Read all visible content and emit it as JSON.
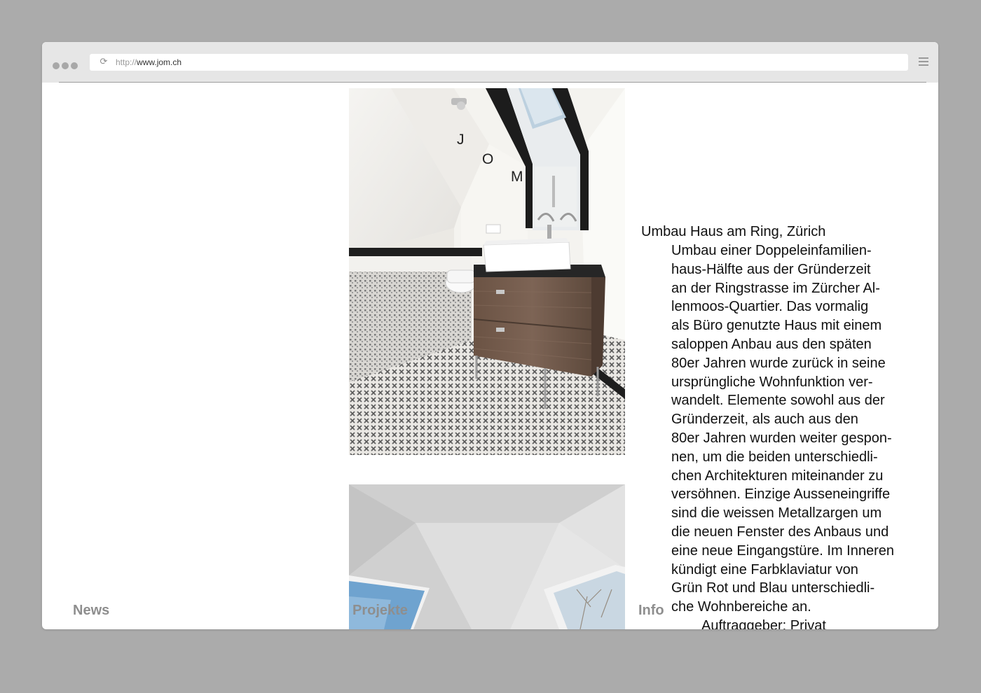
{
  "browser": {
    "url_protocol": "http://",
    "url_host": "www.jom.ch"
  },
  "logo": {
    "letters": [
      "J",
      "O",
      "M"
    ]
  },
  "nav": {
    "news": "News",
    "projekte": "Projekte",
    "info": "Info"
  },
  "project": {
    "title": "Umbau Haus am Ring, Zürich",
    "description_lines": [
      "Umbau einer Doppeleinfamilien-",
      "haus-Hälfte aus der Gründerzeit",
      "an der Ringstrasse im Zürcher Al-",
      "lenmoos-Quartier. Das vormalig",
      "als Büro genutzte Haus mit einem",
      "saloppen Anbau aus den späten",
      "80er Jahren wurde zurück in seine",
      "ursprüngliche Wohnfunktion ver-",
      "wandelt. Elemente sowohl aus der",
      "Gründerzeit, als auch aus den",
      "80er Jahren wurden weiter gespon-",
      "nen, um die beiden unterschiedli-",
      "chen Architekturen miteinander zu",
      "versöhnen. Einzige Ausseneingriffe",
      "sind die weissen Metallzargen um",
      "die neuen Fenster des Anbaus und",
      "eine neue Eingangstüre. Im Inneren",
      "kündigt eine Farbklaviatur von",
      "Grün Rot und Blau unterschiedli-",
      "che Wohnbereiche an."
    ],
    "client": "Auftraggeber: Privat"
  },
  "colors": {
    "background": "#ababab",
    "nav_text": "#8e8e8e",
    "body_text": "#111111"
  }
}
